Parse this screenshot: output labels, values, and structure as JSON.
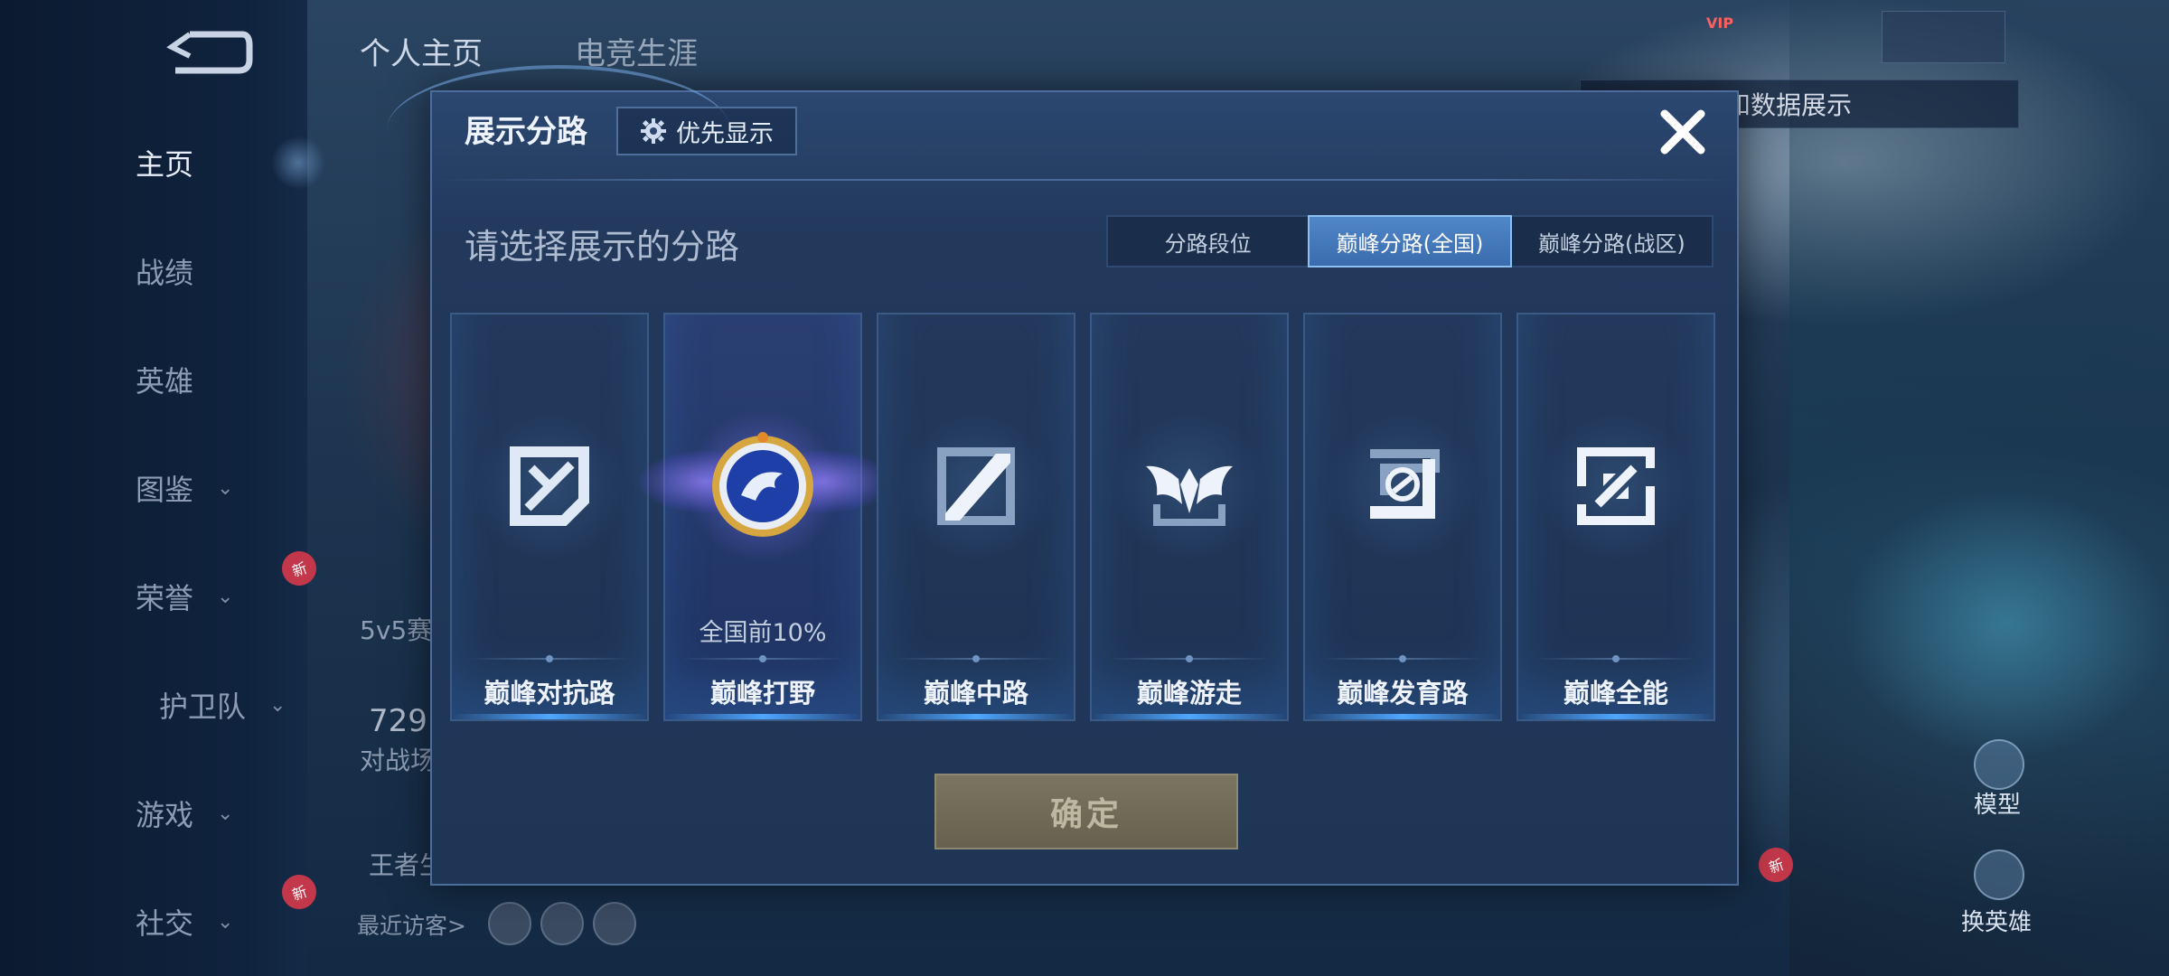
{
  "sidebar": {
    "items": [
      {
        "label": "主页",
        "active": true
      },
      {
        "label": "战绩"
      },
      {
        "label": "英雄"
      },
      {
        "label": "图鉴",
        "has_chevron": true
      },
      {
        "label": "荣誉",
        "has_chevron": true,
        "badge": "新"
      },
      {
        "label": "护卫队",
        "has_chevron": true
      },
      {
        "label": "游戏",
        "has_chevron": true
      },
      {
        "label": "社交",
        "has_chevron": true,
        "badge": "新"
      }
    ]
  },
  "page_tabs": [
    "个人主页",
    "电竞生涯"
  ],
  "background": {
    "hint": "以切换灵宝和数据展示",
    "side_labels": [
      "5v5赛",
      "729",
      "对战场",
      "王者生"
    ],
    "recent_visitors": "最近访客>",
    "model_label": "模型",
    "change_hero_label": "换英雄",
    "new_badge": "新"
  },
  "modal": {
    "title": "展示分路",
    "priority_button": "优先显示",
    "subtitle": "请选择展示的分路",
    "segments": [
      {
        "label": "分路段位",
        "active": false
      },
      {
        "label": "巅峰分路(全国)",
        "active": true
      },
      {
        "label": "巅峰分路(战区)",
        "active": false
      }
    ],
    "cards": [
      {
        "label": "巅峰对抗路",
        "icon": "clash-lane-icon",
        "selected": false,
        "rank": ""
      },
      {
        "label": "巅峰打野",
        "icon": "jungle-dragon-emblem-icon",
        "selected": true,
        "rank": "全国前10%"
      },
      {
        "label": "巅峰中路",
        "icon": "mid-lane-icon",
        "selected": false,
        "rank": ""
      },
      {
        "label": "巅峰游走",
        "icon": "roam-wings-icon",
        "selected": false,
        "rank": ""
      },
      {
        "label": "巅峰发育路",
        "icon": "farm-lane-icon",
        "selected": false,
        "rank": ""
      },
      {
        "label": "巅峰全能",
        "icon": "all-round-icon",
        "selected": false,
        "rank": ""
      }
    ],
    "confirm_button": "确定"
  },
  "colors": {
    "accent": "#4f87c9",
    "modal_bg": "#22395c",
    "confirm_bg": "#6f6a56"
  }
}
